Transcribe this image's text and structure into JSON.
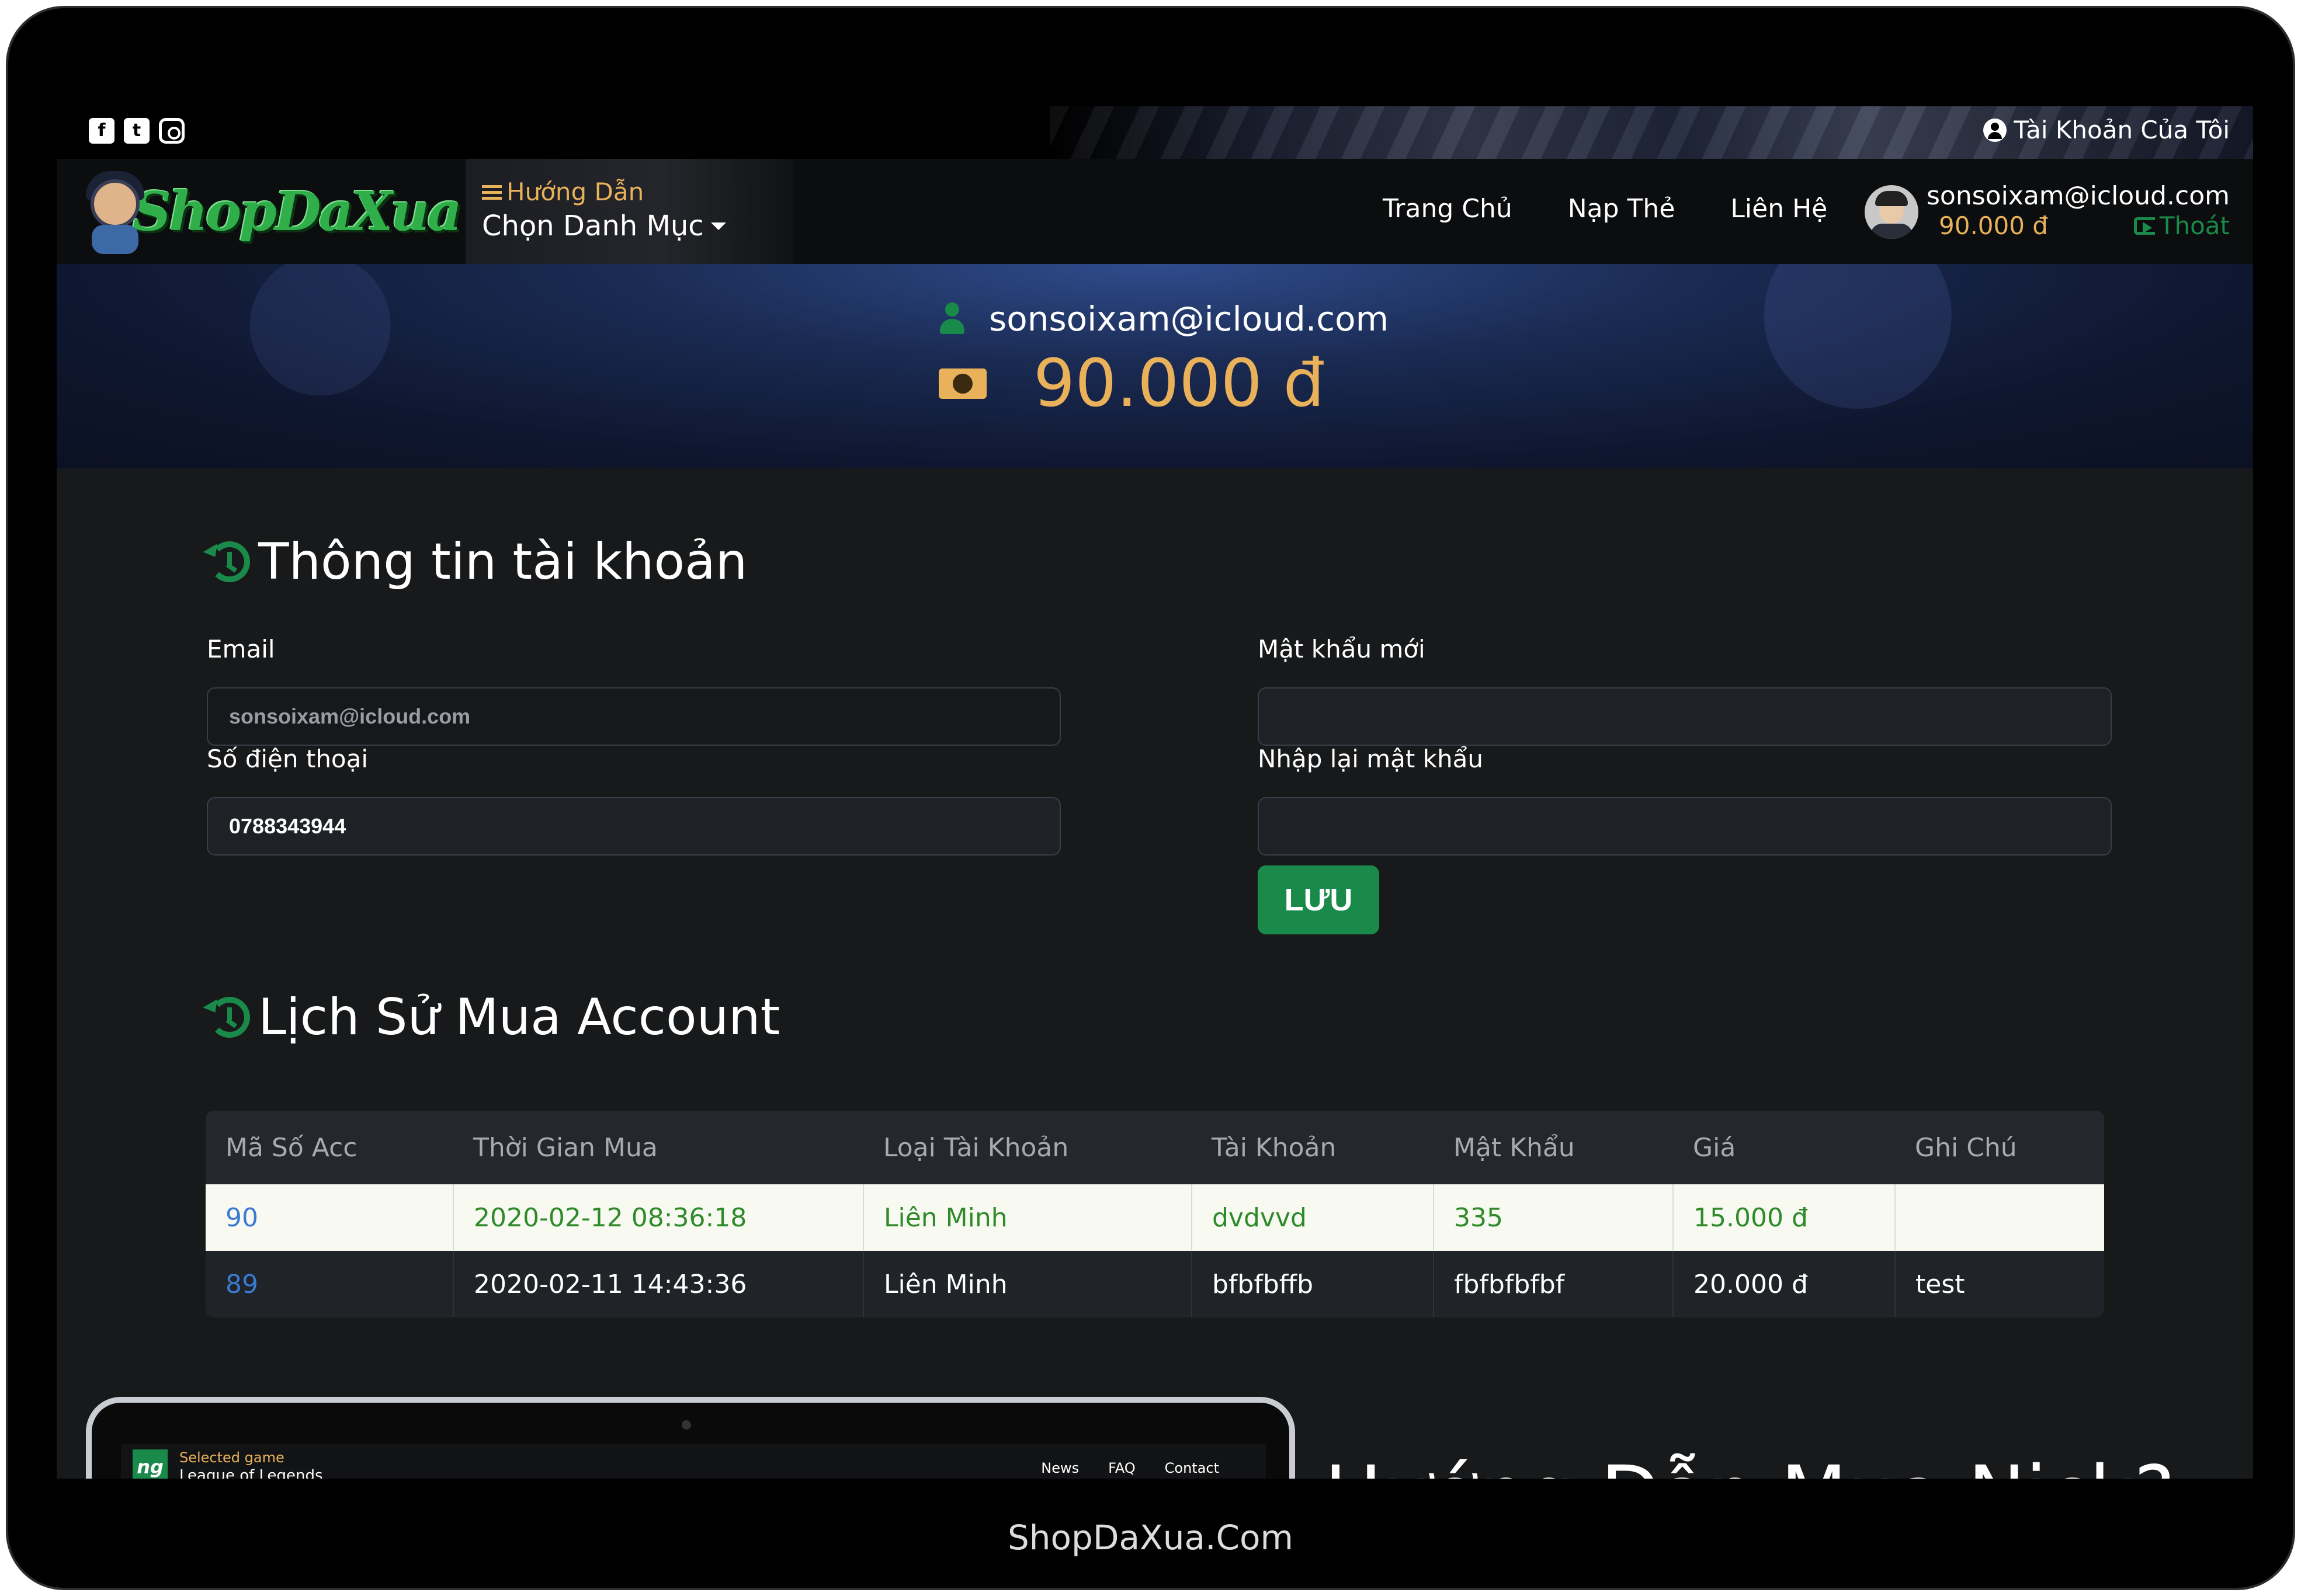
{
  "topbar": {
    "account_link": "Tài Khoản Của Tôi"
  },
  "header": {
    "logo_text": "ShopDaXua",
    "guide_link": "Hướng Dẫn",
    "category_menu": "Chọn Danh Mục",
    "nav": {
      "home": "Trang Chủ",
      "topup": "Nạp Thẻ",
      "contact": "Liên Hệ"
    },
    "user": {
      "email": "sonsoixam@icloud.com",
      "balance": "90.000 đ",
      "logout": "Thoát"
    }
  },
  "banner": {
    "email": "sonsoixam@icloud.com",
    "balance": "90.000 đ"
  },
  "account_info": {
    "title": "Thông tin tài khoản",
    "email_label": "Email",
    "email_value": "sonsoixam@icloud.com",
    "phone_label": "Số điện thoại",
    "phone_value": "0788343944",
    "new_password_label": "Mật khẩu mới",
    "confirm_password_label": "Nhập lại mật khẩu",
    "save_label": "LƯU"
  },
  "history": {
    "title": "Lịch Sử Mua Account",
    "columns": [
      "Mã Số Acc",
      "Thời Gian Mua",
      "Loại Tài Khoản",
      "Tài Khoản",
      "Mật Khẩu",
      "Giá",
      "Ghi Chú"
    ],
    "rows": [
      [
        "90",
        "2020-02-12 08:36:18",
        "Liên Minh",
        "dvdvvd",
        "335",
        "15.000 đ",
        ""
      ],
      [
        "89",
        "2020-02-11 14:43:36",
        "Liên Minh",
        "bfbfbffb",
        "fbfbfbfbf",
        "20.000 đ",
        "test"
      ]
    ]
  },
  "preview": {
    "logo": "ng",
    "menu": "Selected game",
    "subtitle": "League of Legends",
    "nav": [
      "News",
      "FAQ",
      "Contact"
    ]
  },
  "guide_heading": "Hướng Dẫn Mua Nick?",
  "caption": "ShopDaXua.Com",
  "colors": {
    "accent_green": "#1a8a4a",
    "gold": "#e8b15a",
    "background": "#17191b",
    "link_blue": "#3a7ad0"
  }
}
